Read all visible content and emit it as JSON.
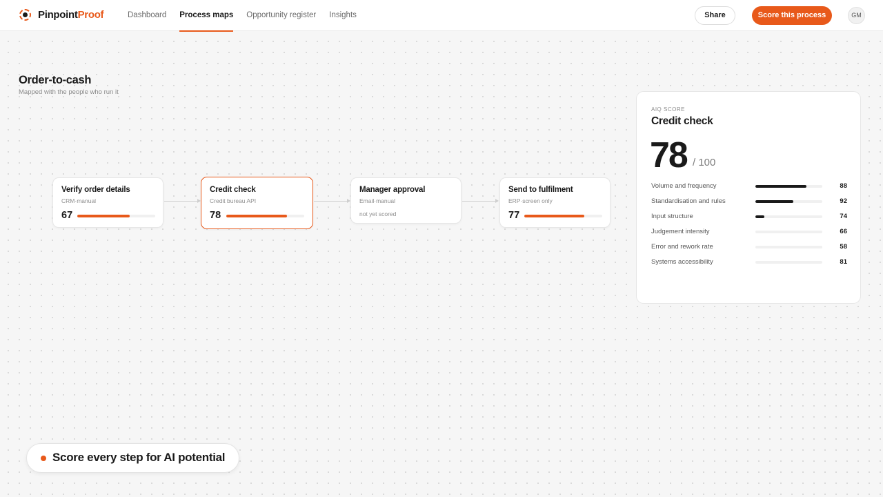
{
  "app": {
    "brand_part1": "Pinpoint",
    "brand_part2": "Proof",
    "accent_color": "#e8591a"
  },
  "nav": {
    "items": [
      {
        "label": "Dashboard",
        "active": false
      },
      {
        "label": "Process maps",
        "active": true
      },
      {
        "label": "Opportunity register",
        "active": false
      },
      {
        "label": "Insights",
        "active": false
      }
    ]
  },
  "header": {
    "share_label": "Share",
    "score_label": "Score this process",
    "avatar_initials": "GM"
  },
  "page": {
    "title": "Order-to-cash",
    "subtitle": "Mapped with the people who run it"
  },
  "steps": [
    {
      "title": "Verify order details",
      "meta": "CRM·manual",
      "score": "67",
      "score_value": 67,
      "selected": false
    },
    {
      "title": "Credit check",
      "meta": "Credit bureau API",
      "score": "78",
      "score_value": 78,
      "selected": true
    },
    {
      "title": "Manager approval",
      "meta": "Email·manual",
      "unscored_label": "not yet scored",
      "selected": false
    },
    {
      "title": "Send to fulfilment",
      "meta": "ERP·screen only",
      "score": "77",
      "score_value": 77,
      "selected": false
    }
  ],
  "panel": {
    "eyebrow": "AIQ SCORE",
    "title": "Credit check",
    "score": "78",
    "max": "/ 100",
    "criteria": [
      {
        "label": "Volume and frequency",
        "value": "88",
        "fill": 0.76
      },
      {
        "label": "Standardisation and rules",
        "value": "92",
        "fill": 0.57
      },
      {
        "label": "Input structure",
        "value": "74",
        "fill": 0.13
      },
      {
        "label": "Judgement intensity",
        "value": "66",
        "fill": 0
      },
      {
        "label": "Error and rework rate",
        "value": "58",
        "fill": 0
      },
      {
        "label": "Systems accessibility",
        "value": "81",
        "fill": 0
      }
    ]
  },
  "callout": {
    "text": "Score every step for AI potential"
  }
}
